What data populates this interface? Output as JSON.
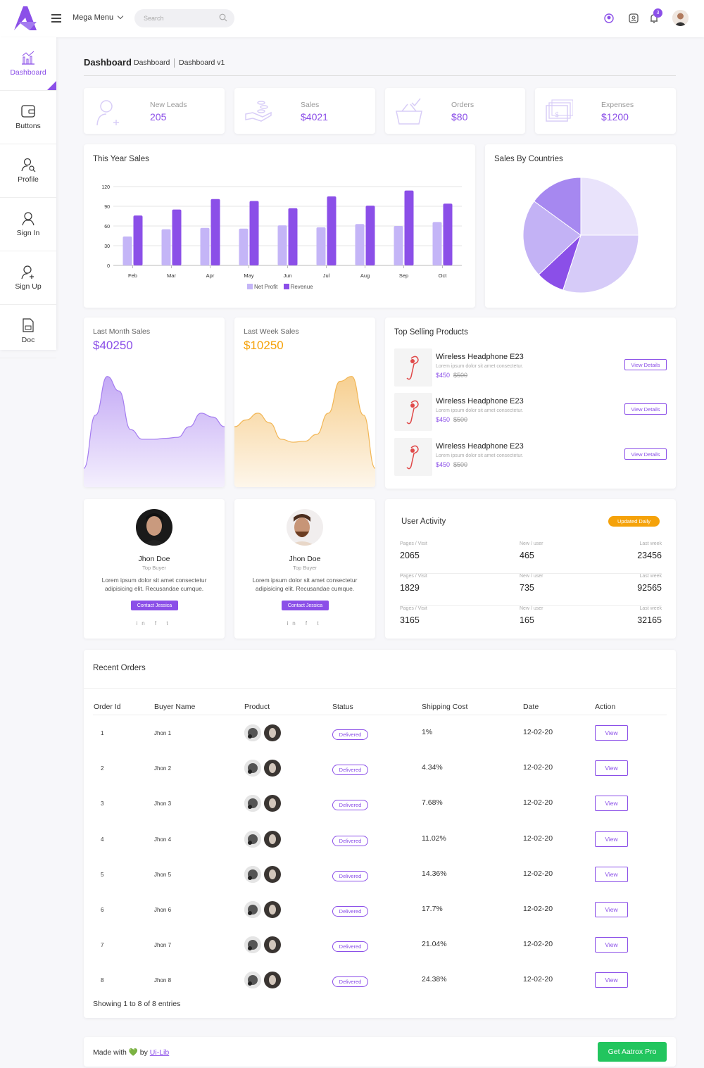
{
  "topbar": {
    "menu_label": "Mega Menu",
    "search_placeholder": "Search",
    "notification_count": "3"
  },
  "sidebar": {
    "items": [
      {
        "label": "Dashboard",
        "icon": "chart-icon",
        "active": true
      },
      {
        "label": "Buttons",
        "icon": "wallet-icon"
      },
      {
        "label": "Profile",
        "icon": "user-search-icon"
      },
      {
        "label": "Sign In",
        "icon": "user-icon"
      },
      {
        "label": "Sign Up",
        "icon": "user-add-icon"
      },
      {
        "label": "Doc",
        "icon": "document-icon"
      }
    ]
  },
  "breadcrumb": {
    "title": "Dashboard",
    "crumb1": "Dashboard",
    "crumb2": "Dashboard v1"
  },
  "stats": [
    {
      "label": "New Leads",
      "value": "205",
      "icon": "user-plus-icon"
    },
    {
      "label": "Sales",
      "value": "$4021",
      "icon": "hand-coins-icon"
    },
    {
      "label": "Orders",
      "value": "$80",
      "icon": "basket-icon"
    },
    {
      "label": "Expenses",
      "value": "$1200",
      "icon": "cash-icon"
    }
  ],
  "this_year_sales": {
    "title": "This Year Sales"
  },
  "sales_by_countries": {
    "title": "Sales By Countries"
  },
  "chart_data": [
    {
      "type": "bar",
      "title": "This Year Sales",
      "categories": [
        "Feb",
        "Mar",
        "Apr",
        "May",
        "Jun",
        "Jul",
        "Aug",
        "Sep",
        "Oct"
      ],
      "series": [
        {
          "name": "Net Profit",
          "values": [
            44,
            55,
            57,
            56,
            61,
            58,
            63,
            60,
            66
          ],
          "color": "#c4b5f7"
        },
        {
          "name": "Revenue",
          "values": [
            76,
            85,
            101,
            98,
            87,
            105,
            91,
            114,
            94
          ],
          "color": "#8b4fe8"
        }
      ],
      "yticks": [
        "0",
        "30",
        "60",
        "90",
        "120"
      ],
      "ylim": [
        0,
        120
      ],
      "grid": true,
      "legend": "bottom"
    },
    {
      "type": "pie",
      "title": "Sales By Countries",
      "values": [
        25,
        30,
        8,
        22,
        15
      ],
      "colors": [
        "#e9e3fb",
        "#d6cbf8",
        "#8b4fe8",
        "#c3b2f5",
        "#a688f0"
      ]
    },
    {
      "type": "area",
      "title": "Last Month Sales",
      "x": [
        0,
        1,
        2,
        3,
        4,
        5,
        6,
        7,
        8,
        9,
        10,
        11,
        12
      ],
      "values": [
        5,
        60,
        100,
        85,
        45,
        35,
        35,
        36,
        37,
        48,
        62,
        58,
        48
      ],
      "ylim": [
        0,
        110
      ],
      "color": "#a47cf0"
    },
    {
      "type": "area",
      "title": "Last Week Sales",
      "x": [
        0,
        1,
        2,
        3,
        4,
        5,
        6,
        7,
        8,
        9,
        10,
        11,
        12
      ],
      "values": [
        48,
        55,
        62,
        52,
        35,
        32,
        33,
        40,
        62,
        95,
        100,
        60,
        5
      ],
      "ylim": [
        0,
        110
      ],
      "color": "#f2b655"
    }
  ],
  "last_month": {
    "title": "Last Month Sales",
    "amount": "$40250"
  },
  "last_week": {
    "title": "Last Week Sales",
    "amount": "$10250"
  },
  "top_products": {
    "title": "Top Selling Products",
    "items": [
      {
        "name": "Wireless Headphone E23",
        "desc": "Lorem ipsum dolor sit amet consectetur.",
        "price": "$450",
        "old_price": "$500",
        "button": "View Details"
      },
      {
        "name": "Wireless Headphone E23",
        "desc": "Lorem ipsum dolor sit amet consectetur.",
        "price": "$450",
        "old_price": "$500",
        "button": "View Details"
      },
      {
        "name": "Wireless Headphone E23",
        "desc": "Lorem ipsum dolor sit amet consectetur.",
        "price": "$450",
        "old_price": "$500",
        "button": "View Details"
      }
    ]
  },
  "profiles": [
    {
      "name": "Jhon Doe",
      "role": "Top Buyer",
      "text": "Lorem ipsum dolor sit amet consectetur adipisicing elit. Recusandae cumque.",
      "button": "Contact Jessica",
      "social": "in f t"
    },
    {
      "name": "Jhon Doe",
      "role": "Top Buyer",
      "text": "Lorem ipsum dolor sit amet consectetur adipisicing elit. Recusandae cumque.",
      "button": "Contact Jessica",
      "social": "in f t"
    }
  ],
  "user_activity": {
    "title": "User Activity",
    "badge": "Updated Daily",
    "rows": [
      {
        "k1": "Pages / Visit",
        "v1": "2065",
        "k2": "New / user",
        "v2": "465",
        "k3": "Last week",
        "v3": "23456"
      },
      {
        "k1": "Pages / Visit",
        "v1": "1829",
        "k2": "New / user",
        "v2": "735",
        "k3": "Last week",
        "v3": "92565"
      },
      {
        "k1": "Pages / Visit",
        "v1": "3165",
        "k2": "New / user",
        "v2": "165",
        "k3": "Last week",
        "v3": "32165"
      }
    ]
  },
  "orders": {
    "title": "Recent Orders",
    "headers": [
      "Order Id",
      "Buyer Name",
      "Product",
      "Status",
      "Shipping Cost",
      "Date",
      "Action"
    ],
    "rows": [
      {
        "id": "1",
        "buyer": "Jhon 1",
        "status": "Delivered",
        "ship": "1%",
        "date": "12-02-20",
        "action": "View"
      },
      {
        "id": "2",
        "buyer": "Jhon 2",
        "status": "Delivered",
        "ship": "4.34%",
        "date": "12-02-20",
        "action": "View"
      },
      {
        "id": "3",
        "buyer": "Jhon 3",
        "status": "Delivered",
        "ship": "7.68%",
        "date": "12-02-20",
        "action": "View"
      },
      {
        "id": "4",
        "buyer": "Jhon 4",
        "status": "Delivered",
        "ship": "11.02%",
        "date": "12-02-20",
        "action": "View"
      },
      {
        "id": "5",
        "buyer": "Jhon 5",
        "status": "Delivered",
        "ship": "14.36%",
        "date": "12-02-20",
        "action": "View"
      },
      {
        "id": "6",
        "buyer": "Jhon 6",
        "status": "Delivered",
        "ship": "17.7%",
        "date": "12-02-20",
        "action": "View"
      },
      {
        "id": "7",
        "buyer": "Jhon 7",
        "status": "Delivered",
        "ship": "21.04%",
        "date": "12-02-20",
        "action": "View"
      },
      {
        "id": "8",
        "buyer": "Jhon 8",
        "status": "Delivered",
        "ship": "24.38%",
        "date": "12-02-20",
        "action": "View"
      }
    ],
    "footer": "Showing 1 to 8 of 8 entries"
  },
  "footer": {
    "made_with": "Made with",
    "heart": "💚",
    "by": "by",
    "link": "Ui-Lib",
    "pro_button": "Get Aatrox Pro"
  },
  "colors": {
    "accent": "#8b4fe8",
    "orange": "#f5a20a",
    "green": "#22c55e"
  }
}
